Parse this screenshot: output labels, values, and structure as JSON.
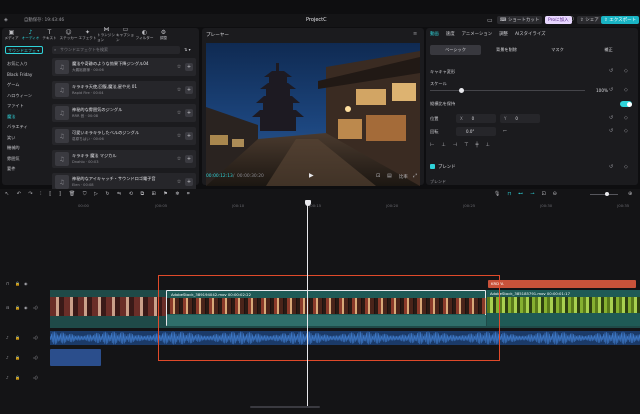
{
  "topbar": {
    "autosave": "自動保存: 19:43:46",
    "project_name": "ProjectC",
    "shortcut_label": "ショートカット",
    "pro_label": "Proに加入",
    "share_label": "シェア",
    "export_label": "エクスポート"
  },
  "toolbar": [
    {
      "name": "media",
      "label": "メディア",
      "icon": "▣"
    },
    {
      "name": "audio",
      "label": "オーディオ",
      "icon": "♪"
    },
    {
      "name": "text",
      "label": "テキスト",
      "icon": "T"
    },
    {
      "name": "sticker",
      "label": "ステッカー",
      "icon": "☺"
    },
    {
      "name": "effects",
      "label": "エフェクト",
      "icon": "✦"
    },
    {
      "name": "transition",
      "label": "トランジション",
      "icon": "⋈"
    },
    {
      "name": "caption",
      "label": "キャプション",
      "icon": "▭"
    },
    {
      "name": "filter",
      "label": "フィルター",
      "icon": "◐"
    },
    {
      "name": "adjust",
      "label": "調整",
      "icon": "⚙"
    }
  ],
  "audio_sidebar": {
    "dropdown": "サウンドエフェ",
    "search_placeholder": "サウンドエフェクトを検索",
    "sort_label": "すべて",
    "categories": [
      "お気に入り",
      "Black Friday",
      "ゲーム",
      "ハロウィーン",
      "ファイト",
      "魔法",
      "バラエティ",
      "笑い",
      "機械的",
      "雰囲気",
      "要件"
    ],
    "active_category": "魔法"
  },
  "music_list": [
    {
      "title": "魔法や奇跡のような効果下降ジングル04",
      "sub": "大義裕魔様 · 00:06"
    },
    {
      "title": "キラキラ天使,回復,魔法,星や光 01",
      "sub": "Rapid Fire · 00:04"
    },
    {
      "title": "神秘的な雰囲気のジングル",
      "sub": "RRR 音 · 00:08"
    },
    {
      "title": "可愛いキラキラしたベルのジングル",
      "sub": "葛原ちはい · 00:06"
    },
    {
      "title": "キラキラ 魔法 マジカル",
      "sub": "Dnahlo · 00:03"
    },
    {
      "title": "神秘的なアイキャッチ・サウンドロゴ電子音",
      "sub": "Elen · 00:08"
    }
  ],
  "player": {
    "title": "プレーヤー",
    "current_time": "00:00:12:13",
    "total_time": "00:00:30:20",
    "ratio_label": "比率"
  },
  "properties": {
    "tabs": [
      "動画",
      "速度",
      "アニメーション",
      "調整",
      "AIスタイライズ"
    ],
    "active_tab": "動画",
    "subtabs": [
      "ベーシック",
      "背景を削除",
      "マスク",
      "補正"
    ],
    "active_subtab": "ベーシック",
    "transform_label": "キャキャ変形",
    "scale_label": "スケール",
    "scale_value": "100%",
    "scale_fraction": 0.0,
    "uniform_label": "縦横比を保持",
    "position_label": "位置",
    "position_x": "0",
    "position_y": "0",
    "rotate_label": "回転",
    "rotate_value": "0.0°",
    "blend_label": "ブレンド",
    "blend_toggle_label": "ブレンド"
  },
  "timeline": {
    "ticks": [
      "00:00",
      "|00:05",
      "|00:10",
      "|00:15",
      "|00:20",
      "|00:25",
      "|00:30",
      "|00:35",
      "|00:40"
    ],
    "overlay_clip_label": "KRDFA",
    "clip1_label": "AdobeStock_389194042.mov  00:00:02:22",
    "clip2_label": "AdobeStock_385185791.mov  00:00:01:17"
  },
  "colors": {
    "accent": "#2fd3d9",
    "selection": "#e04a2a",
    "export": "#19b4c4"
  }
}
